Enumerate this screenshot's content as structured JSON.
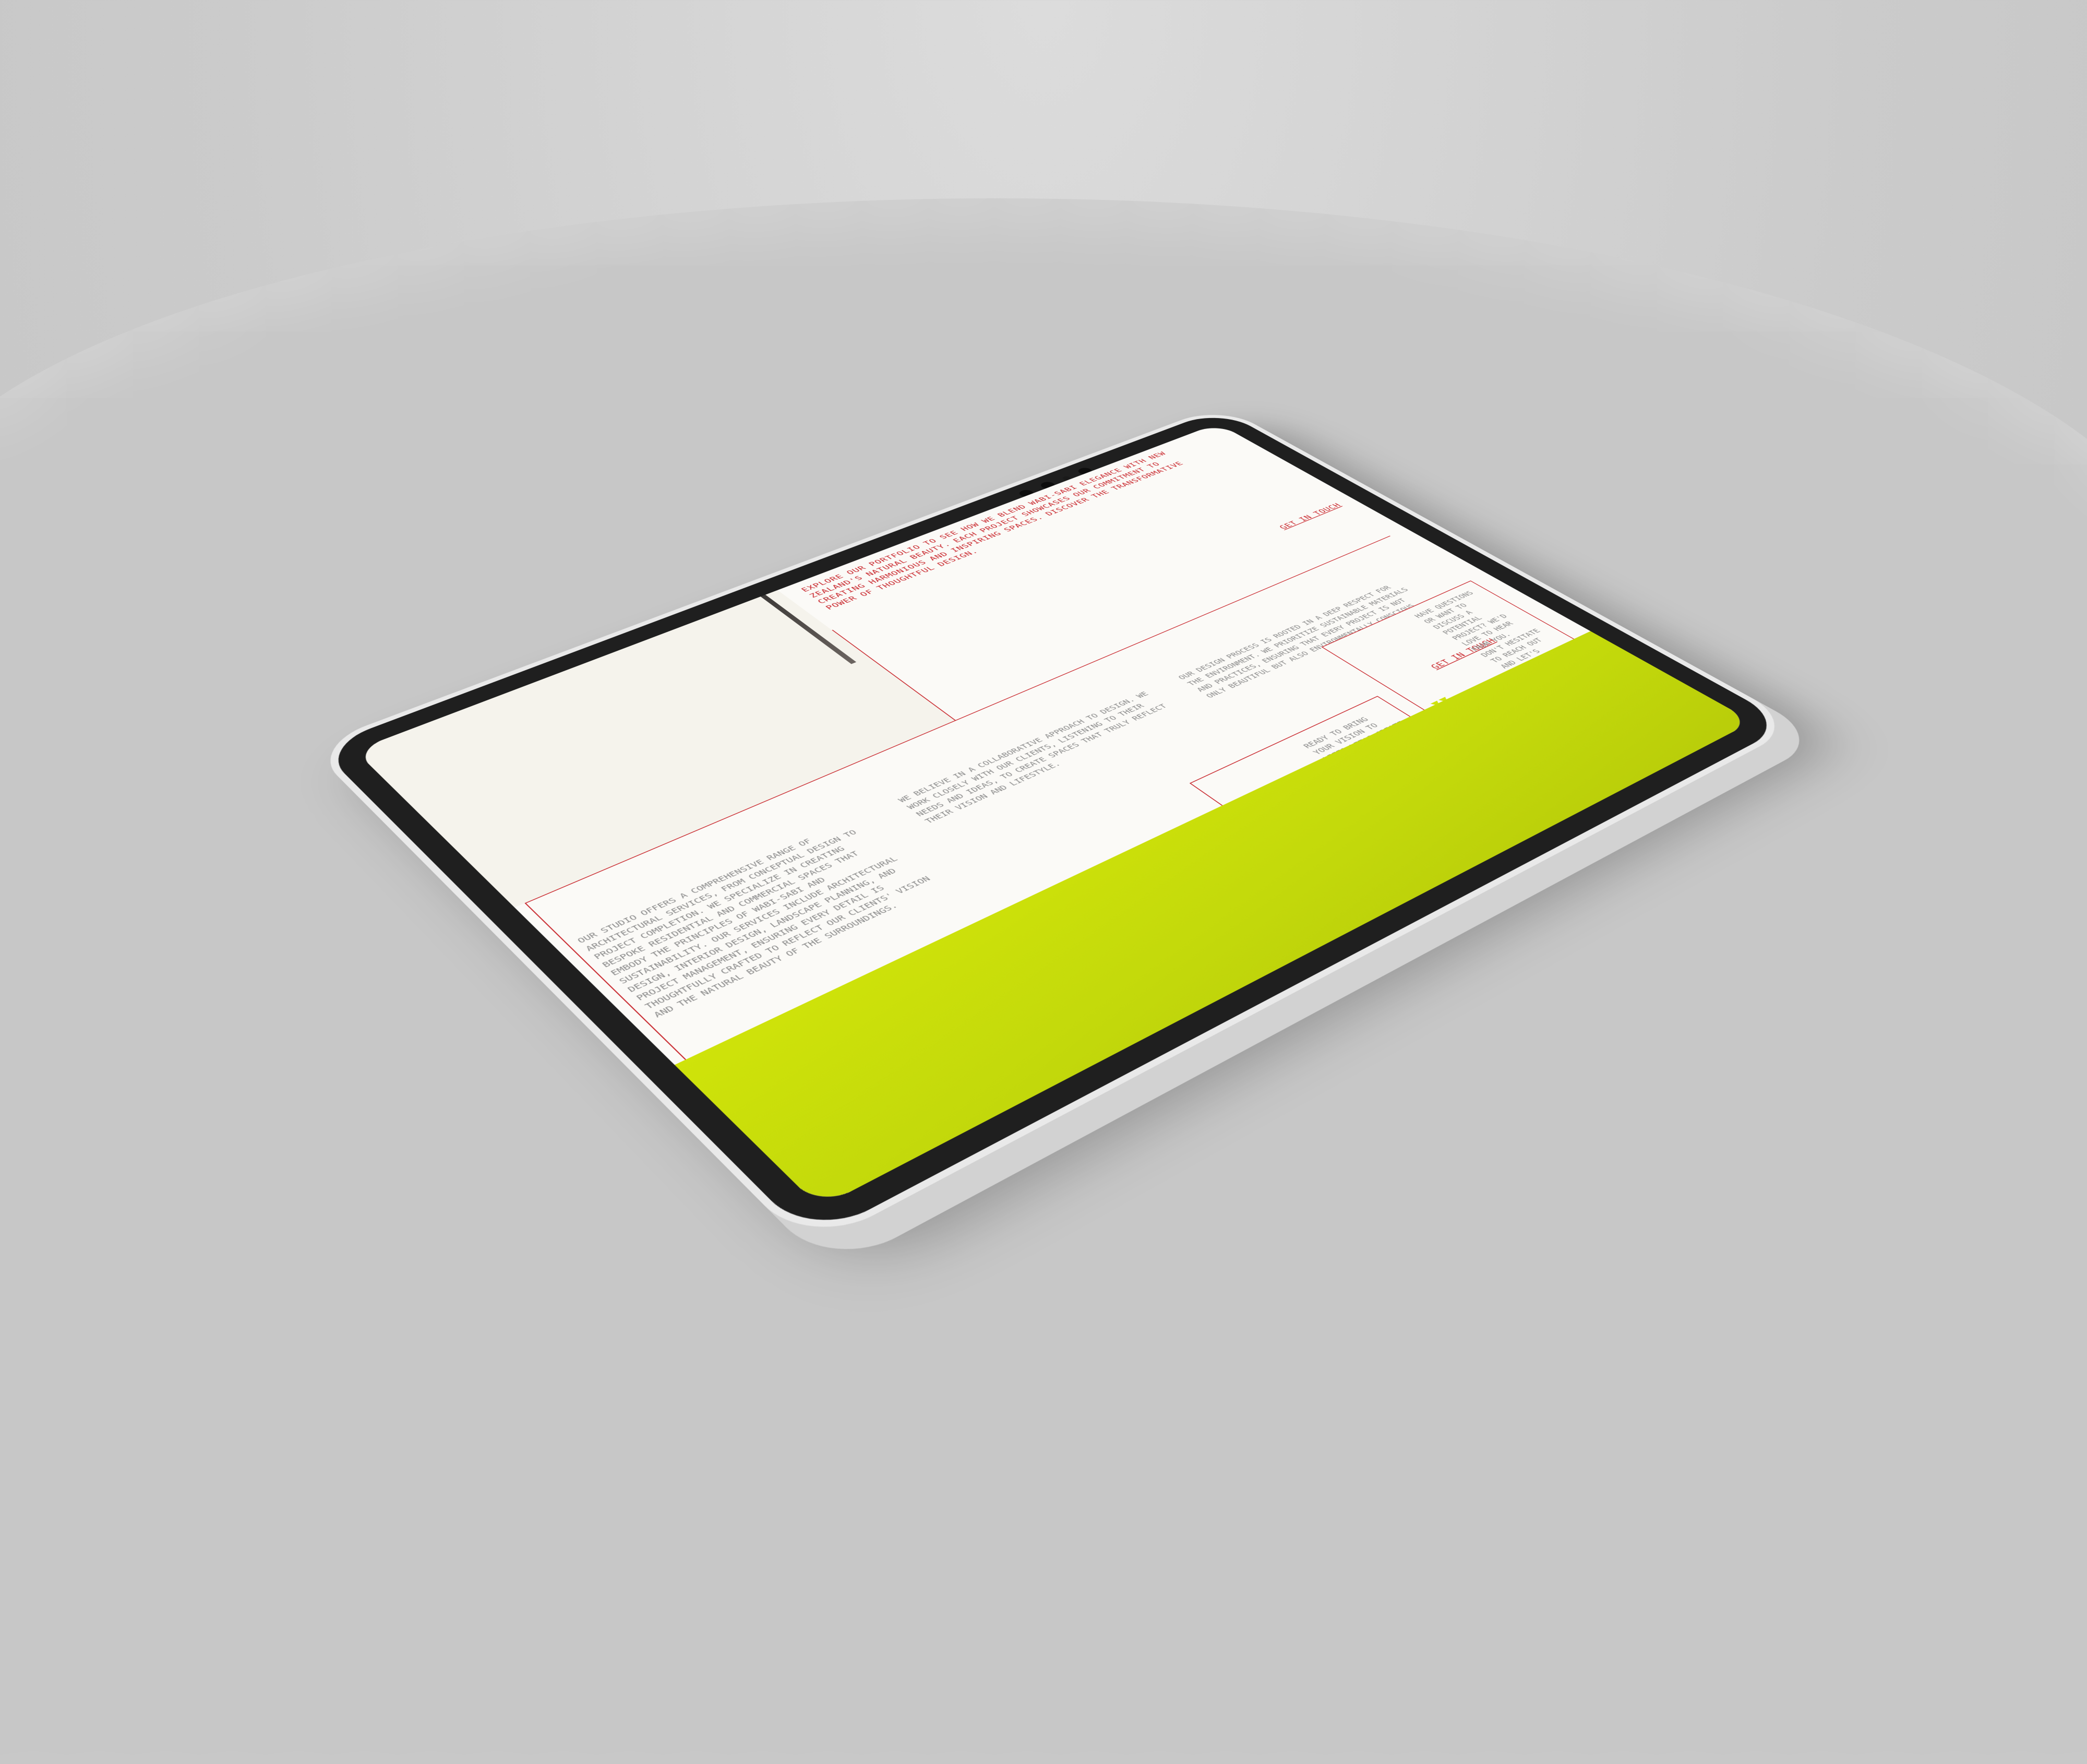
{
  "colors": {
    "accent_red": "#c8252b",
    "accent_lime": "#cfe30a",
    "screen_bg": "#fbfaf7",
    "muted_text": "#8a8a8a"
  },
  "intro": {
    "text": "Explore our portfolio to see how we blend Wabi-Sabi elegance with New Zealand's natural beauty. Each project showcases our commitment to creating harmonious and inspiring spaces. Discover the transformative power of thoughtful design."
  },
  "cta": {
    "get_in_touch_top": "Get in touch",
    "get_in_touch_card": "Get in touch"
  },
  "services": [
    "Our studio offers a comprehensive range of architectural services, from conceptual design to project completion. We specialize in creating bespoke residential and commercial spaces that embody the principles of Wabi-Sabi and sustainability. Our services include architectural design, interior design, landscape planning, and project management, ensuring every detail is thoughtfully crafted to reflect our clients' vision and the natural beauty of the surroundings.",
    "We believe in a collaborative approach to design. We work closely with our clients, listening to their needs and ideas, to create spaces that truly reflect their vision and lifestyle.",
    "Our design process is rooted in a deep respect for the environment. We prioritize sustainable materials and practices, ensuring that every project is not only beautiful but also environmentally conscious."
  ],
  "cards": {
    "vision": "Ready to bring your vision to life? Let's create a space that embodies tranquility and beauty. Whether you're planning a residential or commercial project, we're here to help you realize your dream.",
    "contact": "Have questions or want to discuss a potential project? We'd love to hear from you. Don't hesitate to reach out and let's start a conversation."
  },
  "icons": {
    "card_icon_1": "diamond-shape-icon",
    "card_icon_2": "triangle-cluster-icon"
  }
}
